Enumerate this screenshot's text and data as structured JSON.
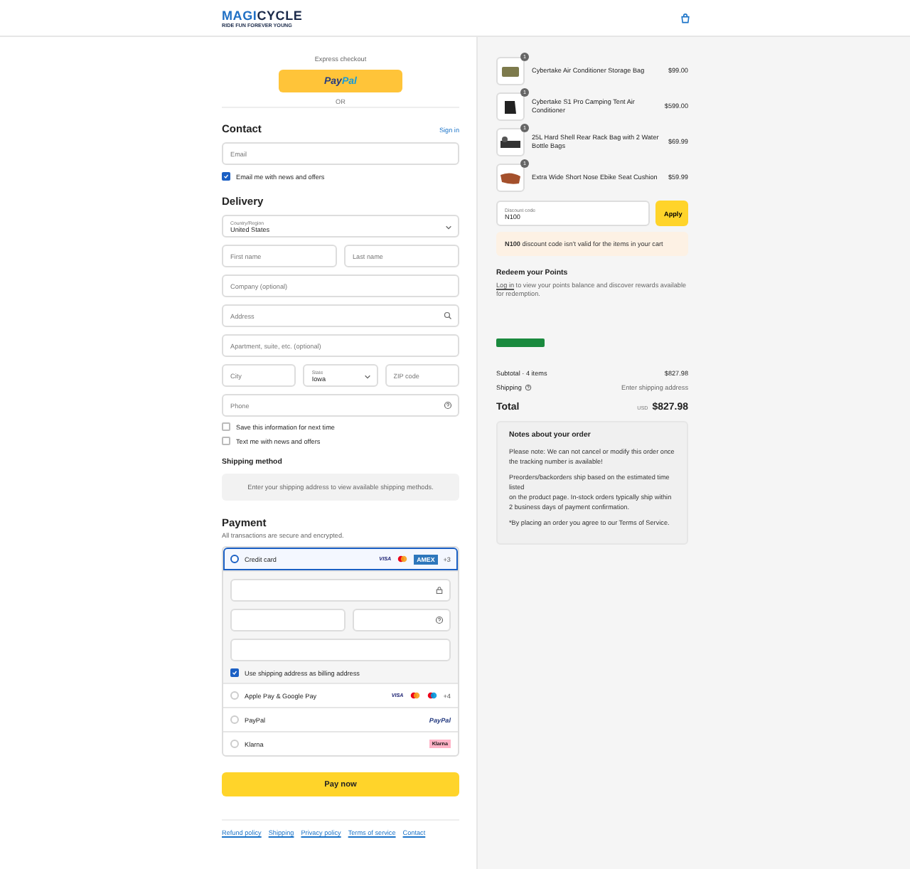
{
  "header": {
    "logo": [
      "MAGI",
      "CYCLE"
    ],
    "tagline": "RIDE FUN FOREVER YOUNG"
  },
  "express": {
    "label": "Express checkout",
    "paypal": [
      "Pay",
      "Pal"
    ],
    "or": "OR"
  },
  "contact": {
    "title": "Contact",
    "sign_in": "Sign in",
    "email": {
      "placeholder": "Email"
    },
    "news": {
      "label": "Email me with news and offers",
      "checked": true
    }
  },
  "delivery": {
    "title": "Delivery",
    "fields": [
      [
        {
          "kind": "select",
          "label": "Country/Region",
          "value": "United States"
        }
      ],
      [
        {
          "kind": "text",
          "placeholder": "First name"
        },
        {
          "kind": "text",
          "placeholder": "Last name"
        }
      ],
      [
        {
          "kind": "text",
          "placeholder": "Company (optional)"
        }
      ],
      [
        {
          "kind": "search",
          "placeholder": "Address"
        }
      ],
      [
        {
          "kind": "text",
          "placeholder": "Apartment, suite, etc. (optional)"
        }
      ],
      [
        {
          "kind": "text",
          "placeholder": "City"
        },
        {
          "kind": "select",
          "label": "State",
          "value": "Iowa"
        },
        {
          "kind": "text",
          "placeholder": "ZIP code"
        }
      ],
      [
        {
          "kind": "help",
          "placeholder": "Phone"
        }
      ]
    ],
    "checks": [
      {
        "label": "Save this information for next time",
        "checked": false
      },
      {
        "label": "Text me with news and offers",
        "checked": false
      }
    ]
  },
  "shipping_method": {
    "title": "Shipping method",
    "note": "Enter your shipping address to view available shipping methods."
  },
  "payment": {
    "title": "Payment",
    "subtitle": "All transactions are secure and encrypted.",
    "methods": [
      {
        "label": "Credit card",
        "selected": true,
        "brands": [
          {
            "kind": "visa",
            "label": "VISA"
          },
          {
            "kind": "mastercard"
          },
          {
            "kind": "amex",
            "label": "AMEX"
          }
        ],
        "more": "+3"
      },
      {
        "label": "Apple Pay & Google Pay",
        "selected": false,
        "brands": [
          {
            "kind": "visa",
            "label": "VISA"
          },
          {
            "kind": "mastercard"
          },
          {
            "kind": "maestro"
          }
        ],
        "more": "+4"
      },
      {
        "label": "PayPal",
        "selected": false,
        "brands": [
          {
            "kind": "paypal",
            "label": "PayPal"
          }
        ]
      },
      {
        "label": "Klarna",
        "selected": false,
        "brands": [
          {
            "kind": "klarna",
            "label": "Klarna"
          }
        ]
      }
    ],
    "billing": {
      "label": "Use shipping address as billing address",
      "checked": true
    },
    "pay_button": "Pay now"
  },
  "footer_links": [
    "Refund policy",
    "Shipping",
    "Privacy policy",
    "Terms of service",
    "Contact"
  ],
  "cart": {
    "items": [
      {
        "name": "Cybertake Air Conditioner Storage Bag",
        "price": "$99.00",
        "qty": "1",
        "kind": "bag"
      },
      {
        "name": "Cybertake S1 Pro Camping Tent Air Conditioner",
        "price": "$599.00",
        "qty": "1",
        "kind": "unit"
      },
      {
        "name": "25L Hard Shell Rear Rack Bag with 2 Water Bottle Bags",
        "price": "$69.99",
        "qty": "1",
        "kind": "rack"
      },
      {
        "name": "Extra Wide Short Nose Ebike Seat Cushion",
        "price": "$59.99",
        "qty": "1",
        "kind": "seat"
      }
    ],
    "discount": {
      "label": "Discount code",
      "value": "N100",
      "button": "Apply"
    },
    "warning": "**N100** discount code isn’t valid for the items in your cart",
    "points": {
      "title": "Redeem your Points",
      "link": "Log in",
      "text": " to view your points balance and discover rewards available for redemption."
    },
    "subtotal": {
      "label": "Subtotal · 4 items",
      "value": "$827.98"
    },
    "shipping": {
      "label": "Shipping",
      "value": "Enter shipping address"
    },
    "total": {
      "label": "Total",
      "currency": "USD",
      "value": "$827.98"
    },
    "notes": {
      "title": "Notes about your order",
      "paragraphs": [
        "Please note: We can not cancel or modify this order once the tracking number is available!",
        "Preorders/backorders ship based on the estimated time listed\non the product page. In-stock orders typically ship within 2 business days of payment confirmation.",
        "*By placing an order you agree to our Terms of Service."
      ]
    }
  }
}
